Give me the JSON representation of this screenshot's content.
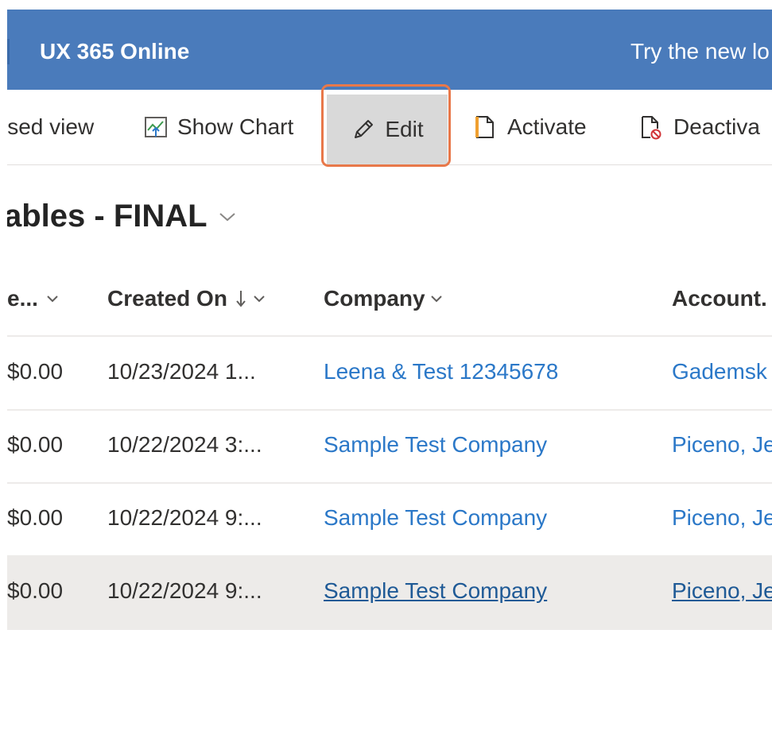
{
  "header": {
    "app_title": "UX 365 Online",
    "try_new": "Try the new lo"
  },
  "toolbar": {
    "focused_view_label": "ised view",
    "show_chart_label": "Show Chart",
    "edit_label": "Edit",
    "activate_label": "Activate",
    "deactivate_label": "Deactiva"
  },
  "view": {
    "title": "ables - FINAL"
  },
  "grid": {
    "columns": [
      "e...",
      "Created On",
      "Company",
      "Account."
    ],
    "rows": [
      [
        "$0.00",
        "10/23/2024 1...",
        "Leena & Test 12345678",
        "Gademsk"
      ],
      [
        "$0.00",
        "10/22/2024 3:...",
        "Sample Test Company",
        "Piceno, Je"
      ],
      [
        "$0.00",
        "10/22/2024 9:...",
        "Sample Test Company",
        "Piceno, Je"
      ],
      [
        "$0.00",
        "10/22/2024 9:...",
        "Sample Test Company",
        "Piceno, Je"
      ]
    ]
  },
  "colors": {
    "header_bg": "#4a7bbb",
    "link": "#2b78c8",
    "highlight": "#e8784a",
    "activate_icon": "#f0a030",
    "deactivate_badge": "#d13438"
  }
}
